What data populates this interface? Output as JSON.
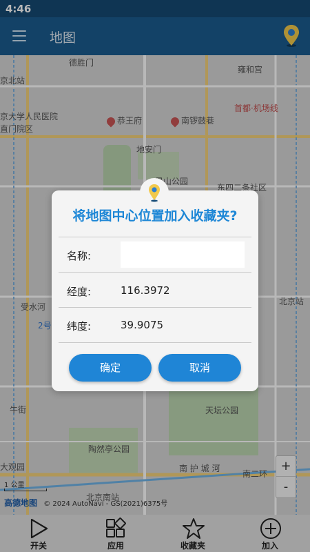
{
  "status_bar": {
    "time": "4:46"
  },
  "app_bar": {
    "title": "地图",
    "menu_icon": "menu-icon",
    "location_icon": "map-pin-icon"
  },
  "map": {
    "labels": {
      "deshengmen": "德胜门",
      "yonghegong": "雍和宫",
      "beizhan": "京北站",
      "renmin_hospital": "京大学人民医院",
      "zhimen_hospital": "直门院区",
      "gongwangfu": "恭王府",
      "nanluoguxiang": "南锣鼓巷",
      "capital_museum": "首都·机场线",
      "dianmen": "地安门",
      "jingshan": "景山公园",
      "dongsi": "东四二条社区",
      "shuiwuhe": "受水河",
      "beijing_station": "北京站",
      "niujie": "牛街",
      "tiantan": "天坛公园",
      "taoranting": "陶然亭公园",
      "daguanyuan": "大观园",
      "nanhuchengriver": "南 护 城 河",
      "nanerhuan": "南二环",
      "beijingnan": "北京南站",
      "line2": "2号"
    },
    "zoom_in": "+",
    "zoom_out": "-",
    "scale": "1 公里",
    "amap_logo": "高德地图",
    "attribution": "© 2024 AutoNavi - GS(2021)6375号"
  },
  "dialog": {
    "title": "将地图中心位置加入收藏夹?",
    "name_label": "名称:",
    "name_value": "",
    "longitude_label": "经度:",
    "longitude_value": "116.3972",
    "latitude_label": "纬度:",
    "latitude_value": "39.9075",
    "confirm_label": "确定",
    "cancel_label": "取消"
  },
  "bottom_nav": {
    "items": [
      {
        "label": "开关",
        "icon": "play-icon"
      },
      {
        "label": "应用",
        "icon": "apps-icon"
      },
      {
        "label": "收藏夹",
        "icon": "star-icon"
      },
      {
        "label": "加入",
        "icon": "add-circle-icon"
      }
    ]
  },
  "colors": {
    "app_bar": "#1b5c8f",
    "status_bar": "#164a73",
    "accent": "#1f85d6"
  }
}
